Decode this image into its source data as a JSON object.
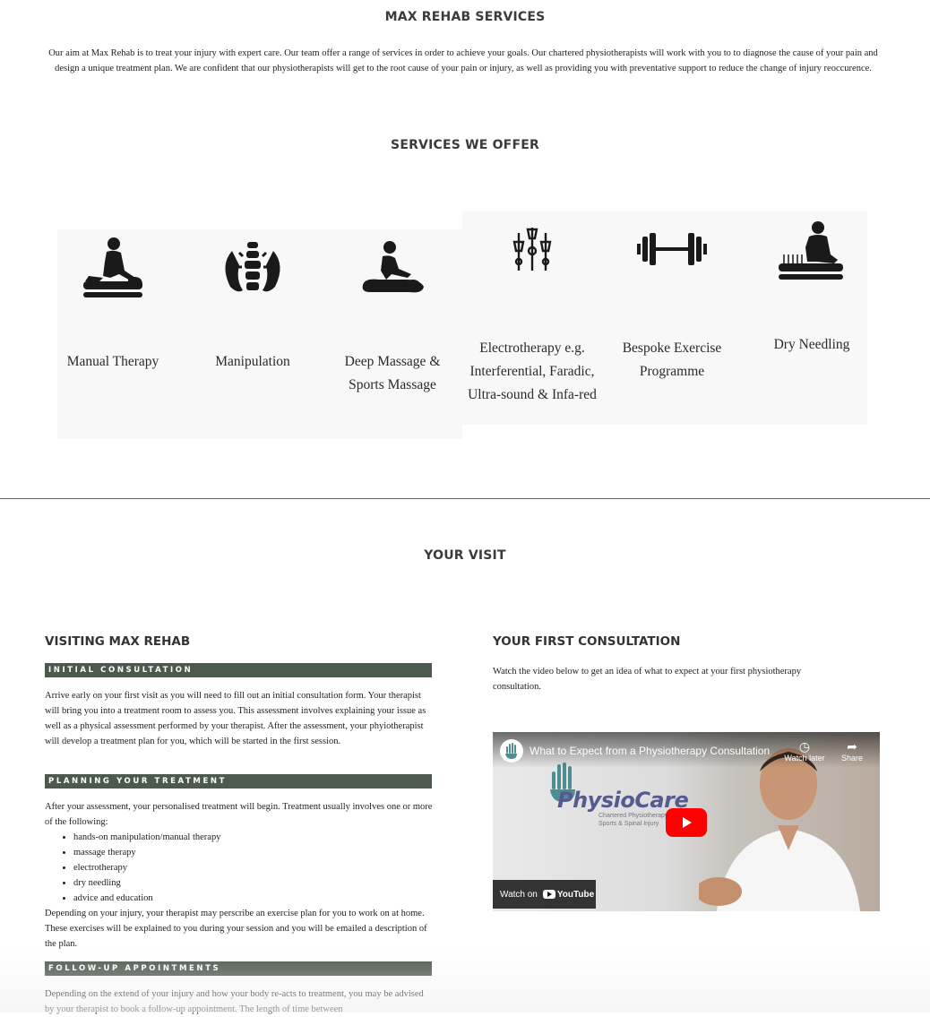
{
  "header": {
    "title": "MAX REHAB SERVICES",
    "intro": "Our aim at Max Rehab is to treat your injury with expert care. Our team offer a range of services in order to achieve your goals. Our chartered physiotherapists will work with you to to diagnose the cause of your pain and design a unique treatment plan. We are confident that our physiotherapists will get to the root cause of your pain or injury, as well as providing you with preventative support to reduce the change of injury reoccurence."
  },
  "services": {
    "title": "SERVICES WE OFFER",
    "items": [
      {
        "label": "Manual Therapy",
        "icon": "manual-therapy-icon"
      },
      {
        "label": "Manipulation",
        "icon": "spine-hands-icon"
      },
      {
        "label": "Deep Massage & Sports Massage",
        "icon": "massage-icon"
      },
      {
        "label": "Electrotherapy e.g. Interferential, Faradic, Ultra-sound & Infa-red",
        "icon": "electrodes-icon"
      },
      {
        "label": "Bespoke Exercise Programme",
        "icon": "barbell-icon"
      },
      {
        "label": "Dry Needling",
        "icon": "needling-icon"
      }
    ]
  },
  "visit": {
    "title": "YOUR VISIT",
    "left": {
      "heading": "VISITING MAX REHAB",
      "sections": [
        {
          "bar": "INITIAL CONSULTATION",
          "text": "Arrive early on your first visit as you will need to fill out an initial consultation form. Your therapist will bring you into a treatment room to assess you. This assessment involves explaining your issue as well as a physical assessment performed by your therapist. After the assessment, your phyiotherapist will develop a treatment plan for you, which will be started in the first session."
        },
        {
          "bar": "PLANNING YOUR TREATMENT",
          "text": "After your assessment, your personalised treatment will begin. Treatment usually involves one or more of the following:",
          "list": [
            "hands-on manipulation/manual therapy",
            "massage therapy",
            "electrotherapy",
            "dry needling",
            "advice and education"
          ],
          "after": "Depending on your injury, your therapist may perscribe an exercise plan for you to work on at home. These exercises will be explained to you during your session and you will be emailed a description of the plan."
        },
        {
          "bar": "FOLLOW-UP APPOINTMENTS",
          "text": "Depending on the extend of your injury and how your body re-acts to treatment, you may be advised by your therapist to book a follow-up appointment. The length of time between"
        }
      ]
    },
    "right": {
      "heading": "YOUR FIRST CONSULTATION",
      "text": "Watch the video below to get an idea of what to expect at your first physiotherapy consultation.",
      "video": {
        "title": "What to Expect from a Physiotherapy Consultation",
        "watch_later": "Watch later",
        "share": "Share",
        "brand": "PhysioCare",
        "brand_sub1": "Chartered Physiotherapy",
        "brand_sub2": "Sports & Spinal Injury",
        "watch_on": "Watch on",
        "youtube": "YouTube"
      }
    }
  }
}
